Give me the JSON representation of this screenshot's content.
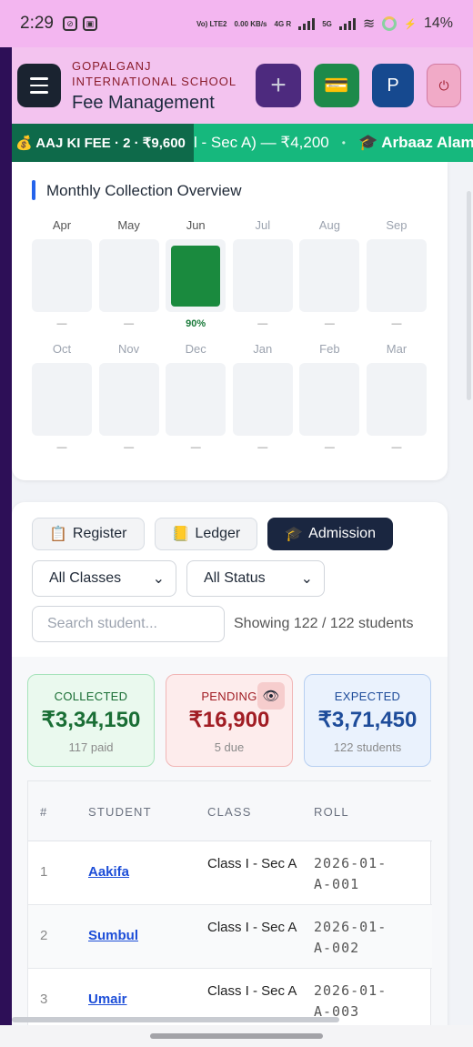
{
  "status": {
    "time": "2:29",
    "network_lines": [
      "Vo) LTE2",
      "0.00 KB/s",
      "4G R",
      "5G"
    ],
    "battery": "14%"
  },
  "header": {
    "school_name": "GOPALGANJ INTERNATIONAL SCHOOL",
    "title": "Fee Management",
    "buttons": {
      "add": "+",
      "fee_card": "💳",
      "profile": "P",
      "exit": "⏻"
    }
  },
  "ticker": {
    "label": "💰 AAJ KI FEE · 2 · ₹9,600",
    "items": [
      "l - Sec A) — ₹4,200",
      "•",
      "🎓 Arbaaz Alam ("
    ]
  },
  "monthly": {
    "title": "Monthly Collection Overview",
    "months": [
      {
        "name": "Apr",
        "pct": "—",
        "fill": 0
      },
      {
        "name": "May",
        "pct": "—",
        "fill": 0
      },
      {
        "name": "Jun",
        "pct": "90%",
        "fill": 0.9
      },
      {
        "name": "Jul",
        "pct": "—",
        "fill": 0
      },
      {
        "name": "Aug",
        "pct": "—",
        "fill": 0
      },
      {
        "name": "Sep",
        "pct": "—",
        "fill": 0
      },
      {
        "name": "Oct",
        "pct": "—",
        "fill": 0
      },
      {
        "name": "Nov",
        "pct": "—",
        "fill": 0
      },
      {
        "name": "Dec",
        "pct": "—",
        "fill": 0
      },
      {
        "name": "Jan",
        "pct": "—",
        "fill": 0
      },
      {
        "name": "Feb",
        "pct": "—",
        "fill": 0
      },
      {
        "name": "Mar",
        "pct": "—",
        "fill": 0
      }
    ]
  },
  "tabs": [
    {
      "icon": "📋",
      "label": "Register"
    },
    {
      "icon": "📒",
      "label": "Ledger"
    },
    {
      "icon": "🎓",
      "label": "Admission"
    }
  ],
  "filters": {
    "class_value": "All Classes",
    "status_value": "All Status",
    "search_placeholder": "Search student...",
    "showing": "Showing 122 / 122 students"
  },
  "summary": {
    "collected": {
      "label": "COLLECTED",
      "value": "₹3,34,150",
      "sub": "117 paid"
    },
    "pending": {
      "label": "PENDING",
      "value": "₹16,900",
      "sub": "5 due"
    },
    "expected": {
      "label": "EXPECTED",
      "value": "₹3,71,450",
      "sub": "122 students"
    }
  },
  "table": {
    "headers": [
      "#",
      "STUDENT",
      "CLASS",
      "ROLL"
    ],
    "rows": [
      {
        "num": "1",
        "name": "Aakifa",
        "class": "Class I - Sec A",
        "roll": "2026-01-A-001"
      },
      {
        "num": "2",
        "name": "Sumbul",
        "class": "Class I - Sec A",
        "roll": "2026-01-A-002"
      },
      {
        "num": "3",
        "name": "Umair",
        "class": "Class I - Sec A",
        "roll": "2026-01-A-003"
      }
    ]
  },
  "colors": {
    "accent": "#1a2640",
    "header_bg": "#f3c3ef",
    "ticker_bg": "#16b87d",
    "fill_green": "#1a8a3e"
  }
}
